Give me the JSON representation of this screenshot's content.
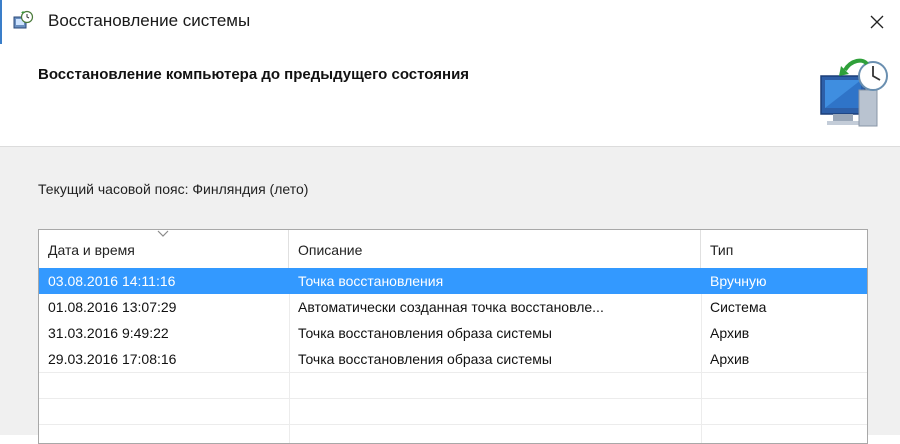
{
  "window": {
    "title": "Восстановление системы"
  },
  "header": {
    "title": "Восстановление компьютера до предыдущего состояния",
    "icon": "system-restore-icon"
  },
  "timezone": {
    "label": "Текущий часовой пояс: Финляндия (лето)"
  },
  "table": {
    "columns": [
      "Дата и время",
      "Описание",
      "Тип"
    ],
    "sort_column": "Дата и время",
    "rows": [
      {
        "date": "03.08.2016 14:11:16",
        "description": "Точка восстановления",
        "type": "Вручную",
        "selected": true
      },
      {
        "date": "01.08.2016 13:07:29",
        "description": "Автоматически созданная точка восстановле...",
        "type": "Система",
        "selected": false
      },
      {
        "date": "31.03.2016 9:49:22",
        "description": "Точка восстановления образа системы",
        "type": "Архив",
        "selected": false
      },
      {
        "date": "29.03.2016 17:08:16",
        "description": "Точка восстановления образа системы",
        "type": "Архив",
        "selected": false
      }
    ]
  },
  "colors": {
    "selection": "#3399ff",
    "window_edge": "#3a7ec9",
    "content_bg": "#f0f0f0"
  }
}
